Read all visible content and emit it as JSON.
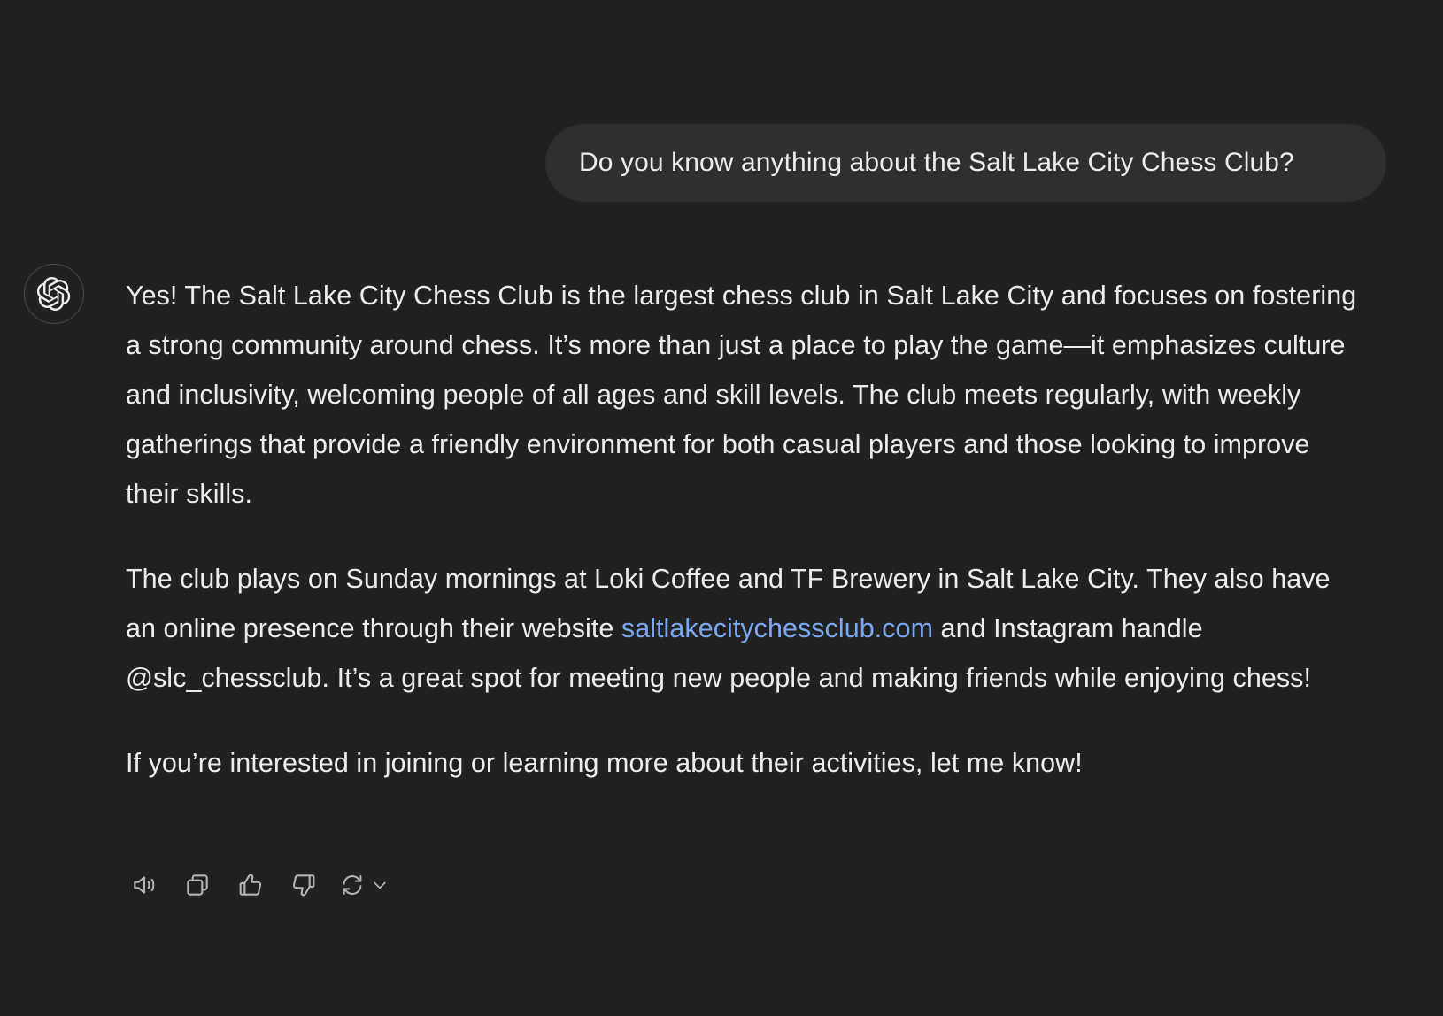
{
  "user_message": "Do you know anything about the Salt Lake City Chess Club?",
  "assistant": {
    "avatar_icon": "openai-logo-icon",
    "p1": "Yes! The Salt Lake City Chess Club is the largest chess club in Salt Lake City and focuses on fostering a strong community around chess. It’s more than just a place to play the game—it emphasizes culture and inclusivity, welcoming people of all ages and skill levels. The club meets regularly, with weekly gatherings that provide a friendly environment for both casual players and those looking to improve their skills.",
    "p2_before": "The club plays on Sunday mornings at Loki Coffee and TF Brewery in Salt Lake City. They also have an online presence through their website ",
    "p2_link": "saltlakecitychessclub.com",
    "p2_after": " and Instagram handle @slc_chessclub. It’s a great spot for meeting new people and making friends while enjoying chess!",
    "p3": "If you’re interested in joining or learning more about their activities, let me know!"
  },
  "actions": {
    "icons": [
      "speaker-icon",
      "copy-icon",
      "thumbs-up-icon",
      "thumbs-down-icon",
      "regenerate-icon",
      "chevron-down-icon"
    ]
  },
  "colors": {
    "background": "#212121",
    "bubble": "#2f2f2f",
    "text": "#ececec",
    "link": "#7aa8f0",
    "icon": "#b4b4b4"
  }
}
